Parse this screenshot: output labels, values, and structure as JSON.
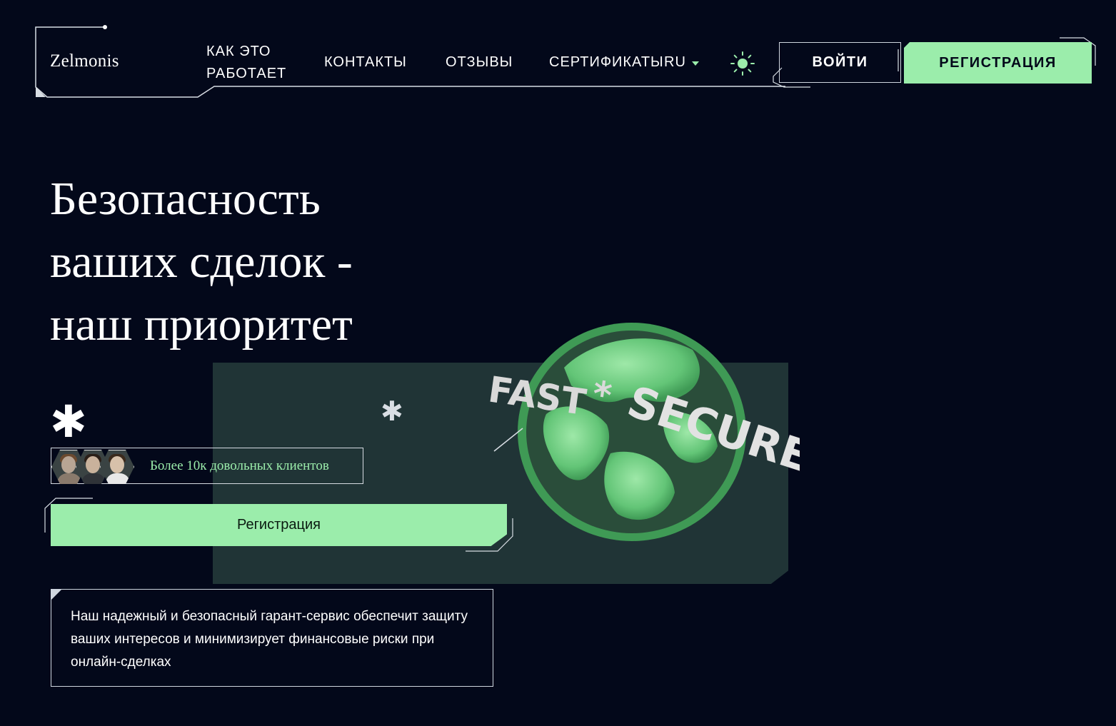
{
  "header": {
    "logo": "Zelmonis",
    "nav": {
      "how_it_works": "КАК ЭТО РАБОТАЕТ",
      "contacts": "КОНТАКТЫ",
      "reviews": "ОТЗЫВЫ",
      "certificates": "СЕРТИФИКАТЫ",
      "language": "RU"
    },
    "theme_icon": "sun-icon",
    "login_label": "ВОЙТИ",
    "register_label": "РЕГИСТРАЦИЯ"
  },
  "hero": {
    "title": "Безопасность ваших сделок - наш приоритет",
    "clients_text": "Более 10к довольных клиентов",
    "cta_label": "Регистрация",
    "description": "Наш надежный и безопасный гарант-сервис обеспечит защиту ваших интересов и минимизирует финансовые риски при онлайн-сделках",
    "globe_text": [
      "FAST",
      "*",
      "SECURE"
    ]
  },
  "colors": {
    "background": "#03081a",
    "accent": "#9bedab",
    "panel": "#203436",
    "text": "#ffffff"
  }
}
